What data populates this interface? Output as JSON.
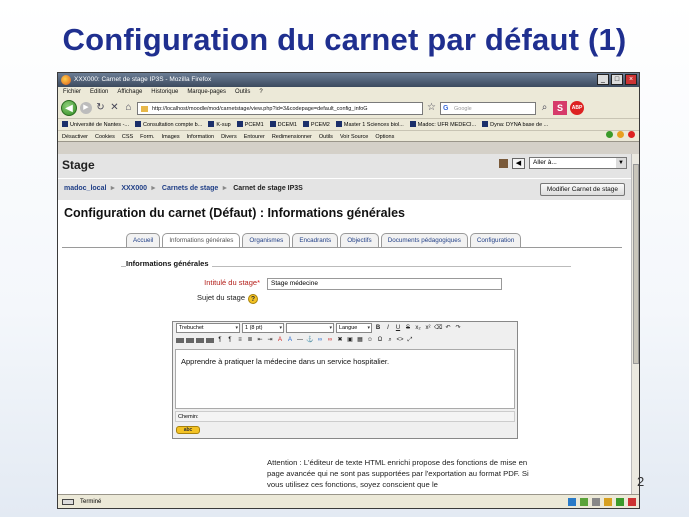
{
  "slide": {
    "title": "Configuration du carnet par défaut (1)",
    "page_number": "2"
  },
  "browser": {
    "window_title": "XXX000: Carnet de stage IP3S - Mozilla Firefox",
    "menu": [
      "Fichier",
      "Edition",
      "Affichage",
      "Historique",
      "Marque-pages",
      "Outils",
      "?"
    ],
    "url": "http://localhost/moodle/mod/carnetstage/view.php?id=3&codepage=default_config_infoG",
    "search_placeholder": "Google",
    "bookmarks": [
      "Université de Nantes -...",
      "Consultation compte b...",
      "K-sup",
      "PCEM1",
      "DCEM1",
      "PCEM2",
      "Master 1 Sciences biol...",
      "Madoc: UFR MEDECI...",
      "Dyna: DYNA base de ..."
    ],
    "devbar": [
      "Désactiver",
      "Cookies",
      "CSS",
      "Form.",
      "Images",
      "Information",
      "Divers",
      "Entourer",
      "Redimensionner",
      "Outils",
      "Voir Source",
      "Options"
    ],
    "status": "Terminé"
  },
  "moodle": {
    "site": "Stage",
    "jump_placeholder": "Aller à...",
    "breadcrumbs": [
      "madoc_local",
      "XXX000",
      "Carnets de stage",
      "Carnet de stage IP3S"
    ],
    "modify_button": "Modifier Carnet de stage",
    "heading": "Configuration du carnet (Défaut) : Informations générales",
    "tabs": [
      "Accueil",
      "Informations générales",
      "Organismes",
      "Encadrants",
      "Objectifs",
      "Documents pédagogiques",
      "Configuration"
    ],
    "active_tab": "Informations générales",
    "legend": "Informations générales",
    "field_title_label": "Intitulé du stage",
    "field_title_value": "Stage médecine",
    "field_subject_label": "Sujet du stage",
    "editor": {
      "font": "Trebuchet",
      "size": "1 (8 pt)",
      "lang": "Langue",
      "content": "Apprendre à pratiquer la médecine dans un service hospitalier.",
      "path_label": "Chemin:"
    },
    "note": "Attention : L'éditeur de texte HTML enrichi propose des fonctions de mise en page avancée qui ne sont pas supportées par l'exportation au format PDF. Si vous utilisez ces fonctions, soyez conscient que le"
  }
}
